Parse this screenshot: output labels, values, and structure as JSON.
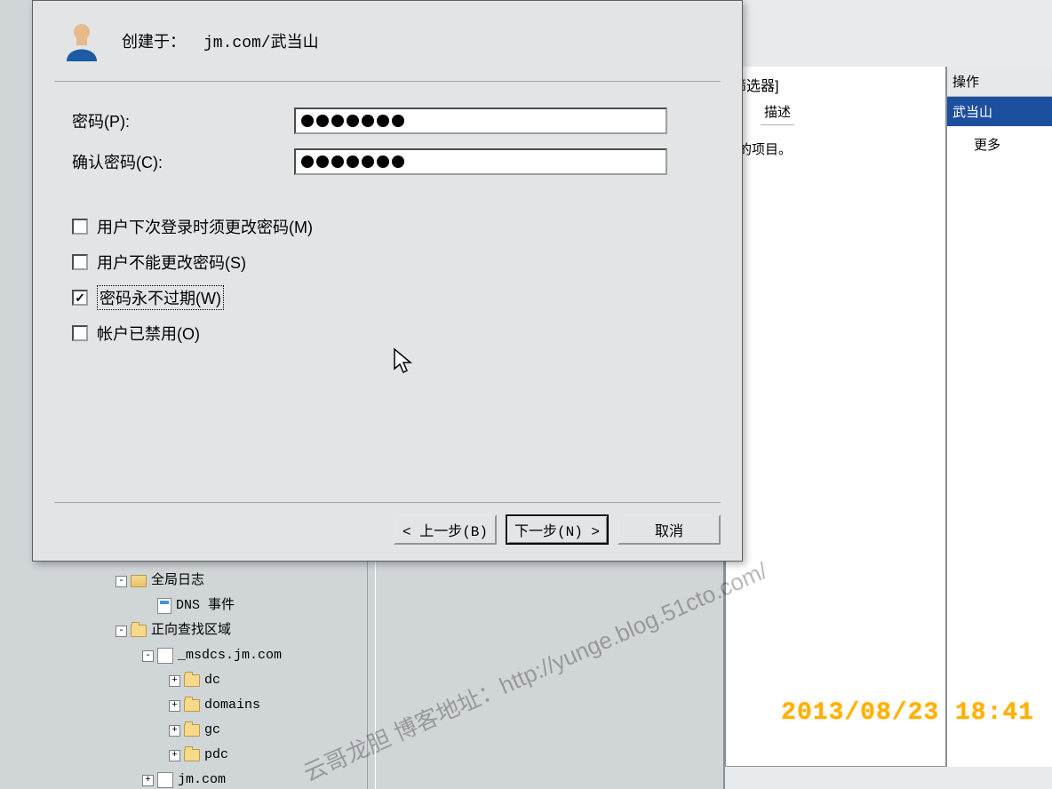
{
  "dialog": {
    "created_in_label": "创建于：",
    "created_in_value": "jm.com/武当山",
    "password_label": "密码(P):",
    "confirm_label": "确认密码(C):",
    "password_mask_len": 7,
    "confirm_mask_len": 7,
    "checkboxes": [
      {
        "label": "用户下次登录时须更改密码(M)",
        "checked": false
      },
      {
        "label": "用户不能更改密码(S)",
        "checked": false
      },
      {
        "label": "密码永不过期(W)",
        "checked": true,
        "focused": true
      },
      {
        "label": "帐户已禁用(O)",
        "checked": false
      }
    ],
    "buttons": {
      "back": "< 上一步(B)",
      "next": "下一步(N) >",
      "cancel": "取消"
    }
  },
  "bg": {
    "filter_fragment": "筛选器]",
    "desc_header": "描述",
    "no_items_fragment": "示的项目。",
    "actions_header": "操作",
    "actions_sel": "武当山",
    "actions_more": "更多"
  },
  "tree": {
    "items": [
      {
        "indent": 0,
        "exp": "-",
        "icon": "log",
        "label": "全局日志"
      },
      {
        "indent": 1,
        "exp": "",
        "icon": "event",
        "label": "DNS 事件"
      },
      {
        "indent": 0,
        "exp": "-",
        "icon": "folder",
        "label": "正向查找区域"
      },
      {
        "indent": 1,
        "exp": "-",
        "icon": "zone",
        "label": "_msdcs.jm.com"
      },
      {
        "indent": 2,
        "exp": "+",
        "icon": "folder",
        "label": "dc"
      },
      {
        "indent": 2,
        "exp": "+",
        "icon": "folder",
        "label": "domains"
      },
      {
        "indent": 2,
        "exp": "+",
        "icon": "folder",
        "label": "gc"
      },
      {
        "indent": 2,
        "exp": "+",
        "icon": "folder",
        "label": "pdc"
      },
      {
        "indent": 1,
        "exp": "+",
        "icon": "zone",
        "label": "jm.com"
      }
    ]
  },
  "watermark": "云哥龙胆 博客地址：http://yunge.blog.51cto.com/",
  "timestamp": "2013/08/23 18:41"
}
